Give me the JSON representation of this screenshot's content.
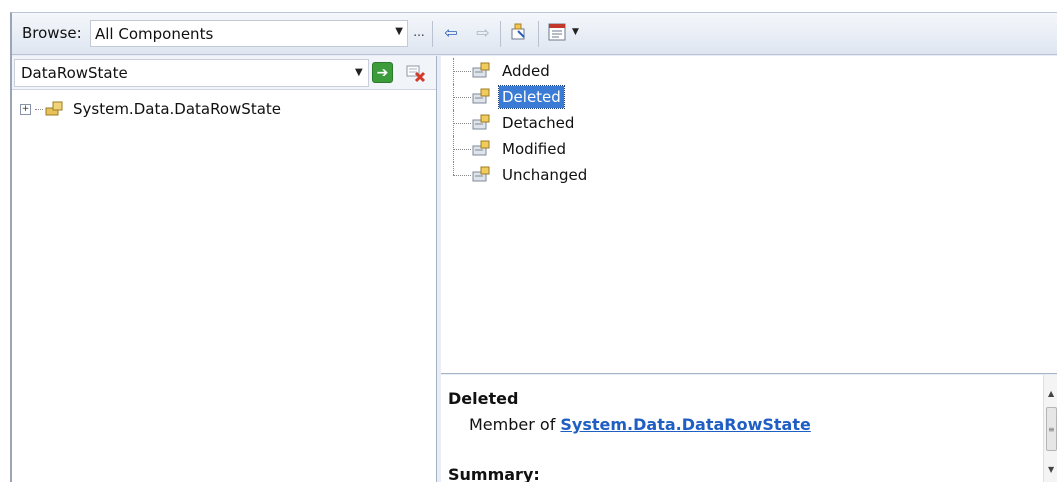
{
  "toolbar": {
    "browse_label": "Browse:",
    "browse_value": "All Components",
    "ellipsis": "..."
  },
  "search": {
    "value": "DataRowState"
  },
  "tree": {
    "items": [
      {
        "label": "System.Data.DataRowState",
        "expander": "+"
      }
    ]
  },
  "members": {
    "items": [
      {
        "label": "Added"
      },
      {
        "label": "Deleted"
      },
      {
        "label": "Detached"
      },
      {
        "label": "Modified"
      },
      {
        "label": "Unchanged"
      }
    ],
    "selected": "Deleted"
  },
  "description": {
    "title": "Deleted",
    "member_of_prefix": "Member of ",
    "member_of_link": "System.Data.DataRowState",
    "summary_label": "Summary:"
  },
  "colors": {
    "selection": "#3a7bd5",
    "link": "#1f5fc4",
    "toolbar_bg": "#dfe6f1"
  }
}
